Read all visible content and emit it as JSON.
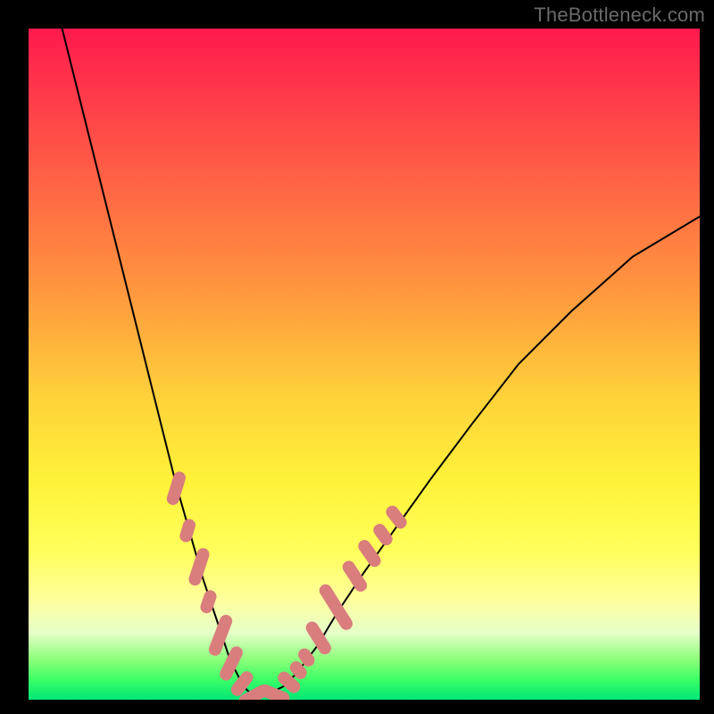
{
  "watermark": "TheBottleneck.com",
  "chart_data": {
    "type": "line",
    "title": "",
    "xlabel": "",
    "ylabel": "",
    "xlim": [
      0,
      100
    ],
    "ylim": [
      0,
      100
    ],
    "background_gradient": {
      "direction": "vertical",
      "stops": [
        {
          "pos": 0,
          "color": "#ff1a4d"
        },
        {
          "pos": 55,
          "color": "#ffd23a"
        },
        {
          "pos": 85,
          "color": "#ffff9c"
        },
        {
          "pos": 100,
          "color": "#00e676"
        }
      ]
    },
    "series": [
      {
        "name": "left-curve",
        "stroke": "#000000",
        "x": [
          5,
          8,
          11,
          14,
          17,
          20,
          22,
          24,
          26,
          28,
          29,
          30,
          31,
          32,
          33,
          34
        ],
        "y": [
          100,
          88,
          76,
          64,
          52,
          40,
          32,
          25,
          18,
          12,
          9,
          6,
          4,
          2,
          1,
          0
        ]
      },
      {
        "name": "right-curve",
        "stroke": "#000000",
        "x": [
          34,
          36,
          38,
          40,
          43,
          46,
          50,
          55,
          60,
          66,
          73,
          81,
          90,
          100
        ],
        "y": [
          0,
          1,
          2,
          4,
          8,
          13,
          19,
          26,
          33,
          41,
          50,
          58,
          66,
          72
        ]
      }
    ],
    "markers": [
      {
        "name": "left-segment-markers",
        "shape": "rounded-pill",
        "color": "#d97d7d",
        "points": [
          {
            "x": 22.0,
            "y": 31.5,
            "len": 3.2,
            "angle": -73
          },
          {
            "x": 23.7,
            "y": 25.2,
            "len": 2.2,
            "angle": -73
          },
          {
            "x": 25.4,
            "y": 19.8,
            "len": 3.6,
            "angle": -72
          },
          {
            "x": 26.8,
            "y": 14.6,
            "len": 2.2,
            "angle": -71
          },
          {
            "x": 28.6,
            "y": 9.6,
            "len": 4.0,
            "angle": -69
          },
          {
            "x": 30.2,
            "y": 5.4,
            "len": 3.4,
            "angle": -64
          },
          {
            "x": 31.8,
            "y": 2.4,
            "len": 2.6,
            "angle": -52
          },
          {
            "x": 33.6,
            "y": 0.6,
            "len": 3.0,
            "angle": -28
          }
        ]
      },
      {
        "name": "right-segment-markers",
        "shape": "rounded-pill",
        "color": "#d97d7d",
        "points": [
          {
            "x": 36.6,
            "y": 0.8,
            "len": 3.0,
            "angle": 22
          },
          {
            "x": 38.8,
            "y": 2.6,
            "len": 2.4,
            "angle": 42
          },
          {
            "x": 40.2,
            "y": 4.4,
            "len": 1.8,
            "angle": 50
          },
          {
            "x": 41.4,
            "y": 6.3,
            "len": 1.8,
            "angle": 55
          },
          {
            "x": 43.2,
            "y": 9.2,
            "len": 3.4,
            "angle": 58
          },
          {
            "x": 45.8,
            "y": 13.8,
            "len": 4.8,
            "angle": 58
          },
          {
            "x": 48.6,
            "y": 18.4,
            "len": 3.2,
            "angle": 57
          },
          {
            "x": 50.8,
            "y": 21.8,
            "len": 2.8,
            "angle": 55
          },
          {
            "x": 52.8,
            "y": 24.6,
            "len": 2.2,
            "angle": 54
          },
          {
            "x": 54.8,
            "y": 27.2,
            "len": 2.4,
            "angle": 52
          }
        ]
      }
    ]
  }
}
